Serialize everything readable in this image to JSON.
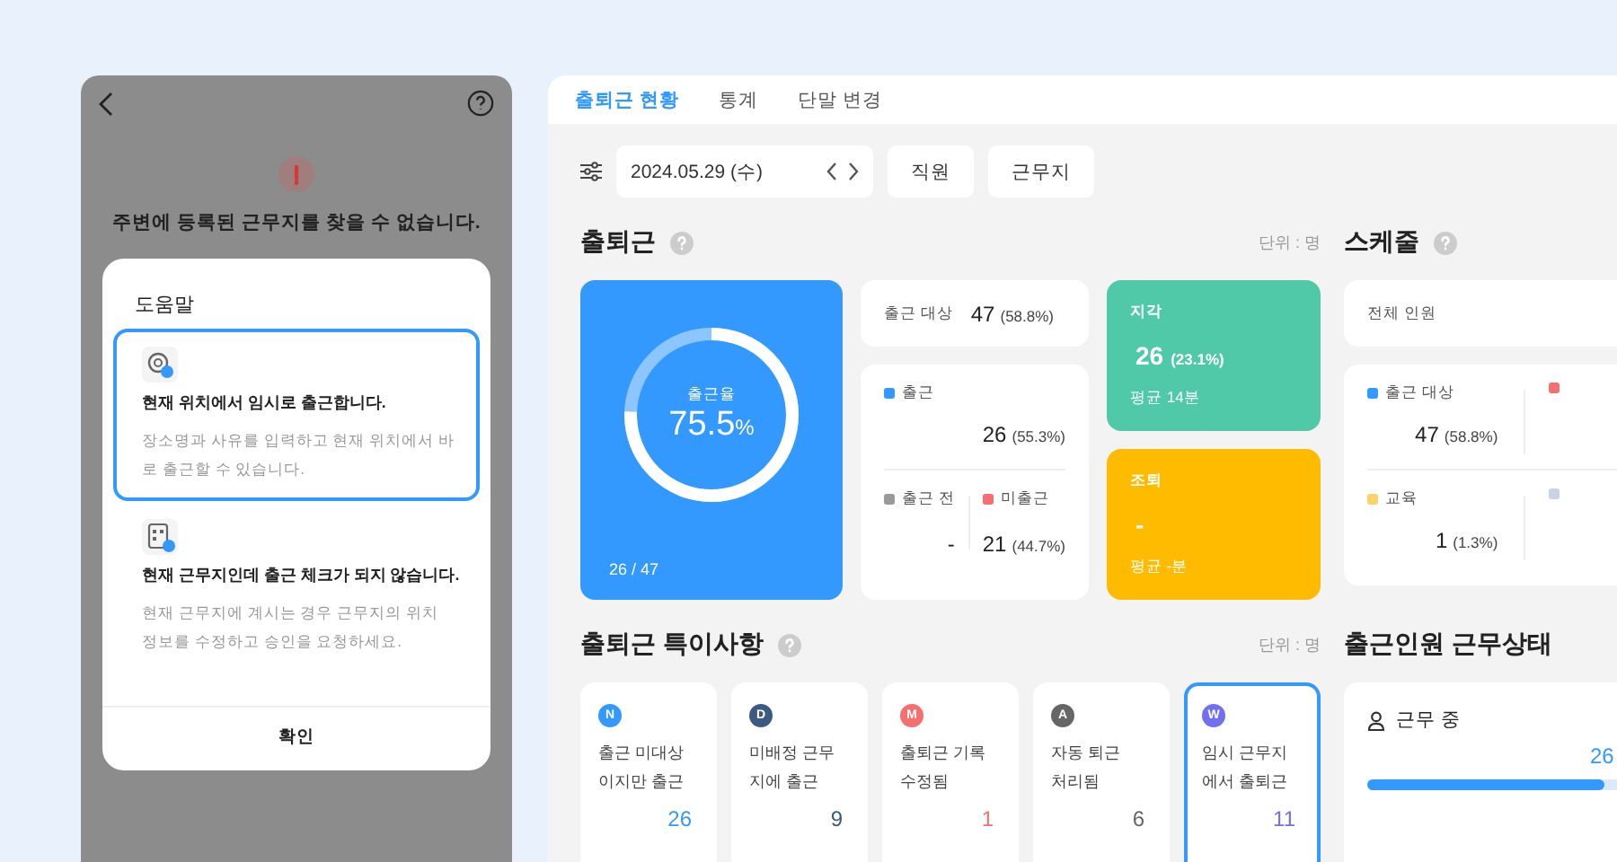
{
  "phone": {
    "title": "주변에 등록된 근무지를 찾을 수 없습니다.",
    "dialog": {
      "heading": "도움말",
      "options": [
        {
          "kind": "location",
          "title": "현재 위치에서 임시로 출근합니다.",
          "description": "장소명과 사유를 입력하고 현재 위치에서 바로 출근할 수 있습니다.",
          "selected": true
        },
        {
          "kind": "building",
          "title": "현재 근무지인데 출근 체크가 되지 않습니다.",
          "description": "현재 근무지에 계시는 경우 근무지의 위치 정보를 수정하고 승인을 요청하세요.",
          "selected": false
        }
      ],
      "button": "확인"
    }
  },
  "tabs": [
    {
      "label": "출퇴근 현황",
      "selected": true
    },
    {
      "label": "통계",
      "selected": false
    },
    {
      "label": "단말 변경",
      "selected": false
    }
  ],
  "filter": {
    "date": "2024.05.29 (수)",
    "buttons": [
      "직원",
      "근무지"
    ]
  },
  "attendance": {
    "title": "출퇴근",
    "unit": "단위 : 명",
    "rate_label": "출근율",
    "rate": "75.5",
    "rate_unit": "%",
    "level": 0.755,
    "ratio": "26 / 47",
    "target": {
      "label": "출근 대상",
      "value": "47",
      "pct": "(58.8%)"
    },
    "checkin": {
      "label": "출근",
      "value": "26",
      "pct": "(55.3%)",
      "color": "#3399ff"
    },
    "before": {
      "label": "출근 전",
      "value": "-",
      "color": "#999999"
    },
    "absent": {
      "label": "미출근",
      "value": "21",
      "pct": "(44.7%)",
      "color": "#f46f6f"
    },
    "late": {
      "label": "지각",
      "value": "26",
      "pct": "(23.1%)",
      "avg": "평균 14분"
    },
    "early": {
      "label": "조퇴",
      "value": "-",
      "avg": "평균 -분"
    }
  },
  "schedule": {
    "title": "스케줄",
    "total_label": "전체 인원",
    "rows": [
      [
        {
          "label": "출근 대상",
          "value": "47",
          "pct": "(58.8%)",
          "color": "#3399ff"
        },
        {
          "color": "#f46f6f"
        }
      ],
      [
        {
          "label": "교육",
          "value": "1",
          "pct": "(1.3%)",
          "color": "#ffd36b"
        },
        {
          "color": "#c9d3e6"
        }
      ]
    ]
  },
  "specials": {
    "title": "출퇴근 특이사항",
    "unit": "단위 : 명",
    "items": [
      {
        "badge": "N",
        "color": "#3399ff",
        "label": "출근 미대상\n이지만 출근",
        "count": "26",
        "selected": false
      },
      {
        "badge": "D",
        "color": "#3c5a80",
        "label": "미배정 근무\n지에 출근",
        "count": "9",
        "selected": false
      },
      {
        "badge": "M",
        "color": "#f46f6f",
        "label": "출퇴근 기록\n수정됨",
        "count": "1",
        "selected": false
      },
      {
        "badge": "A",
        "color": "#666666",
        "label": "자동 퇴근\n처리됨",
        "count": "6",
        "selected": false
      },
      {
        "badge": "W",
        "color": "#7070f0",
        "label": "임시 근무지\n에서 출퇴근",
        "count": "11",
        "selected": true
      }
    ]
  },
  "work_status": {
    "title": "출근인원 근무상태",
    "items": [
      {
        "label": "근무 중",
        "value": "26",
        "level": 0.88
      }
    ]
  }
}
